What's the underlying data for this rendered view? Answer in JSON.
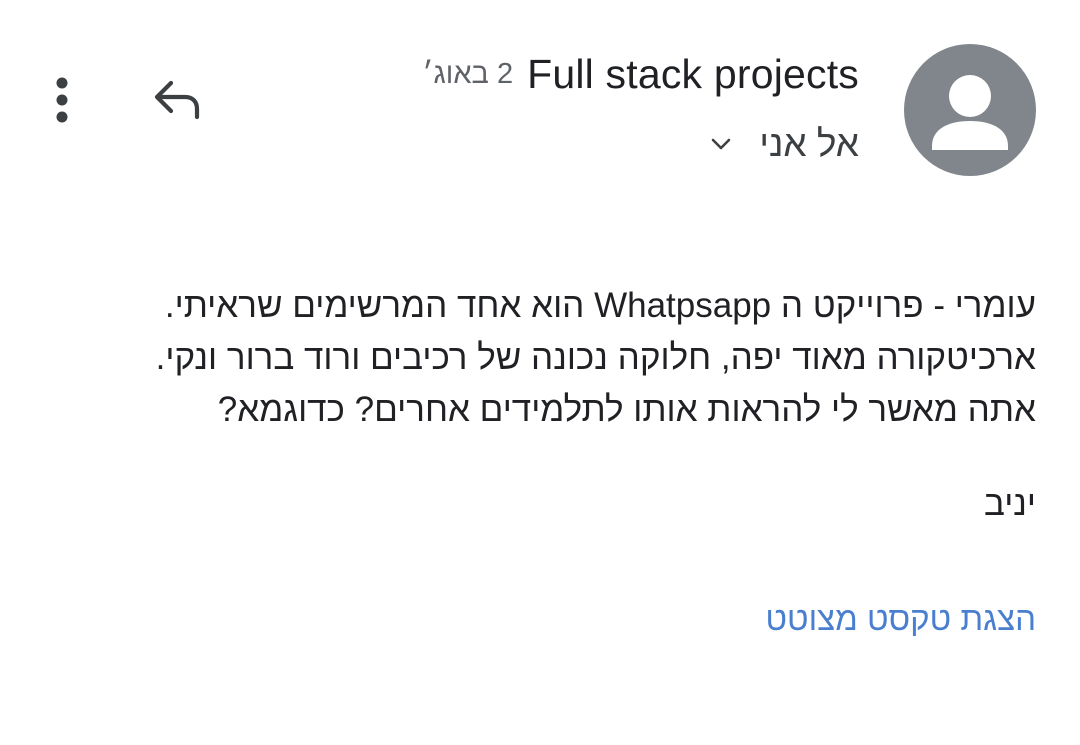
{
  "header": {
    "sender": "Full stack projects",
    "date": "2 באוג׳",
    "recipient": "אל אני"
  },
  "icons": {
    "avatar": "person-avatar-icon",
    "expand": "chevron-down-icon",
    "reply": "reply-icon",
    "more": "more-vert-icon"
  },
  "colors": {
    "avatar_bg": "#80868b",
    "link": "#4a7fd0",
    "text": "#202124"
  },
  "message": {
    "lines": [
      "עומרי - פרוייקט ה Whatpsapp הוא אחד המרשימים שראיתי.",
      "ארכיטקורה מאוד יפה, חלוקה נכונה של רכיבים ורוד ברור ונקי.",
      "אתה מאשר לי להראות אותו לתלמידים אחרים? כדוגמא?"
    ],
    "signature": "יניב"
  },
  "actions": {
    "show_quoted_text": "הצגת טקסט מצוטט"
  }
}
